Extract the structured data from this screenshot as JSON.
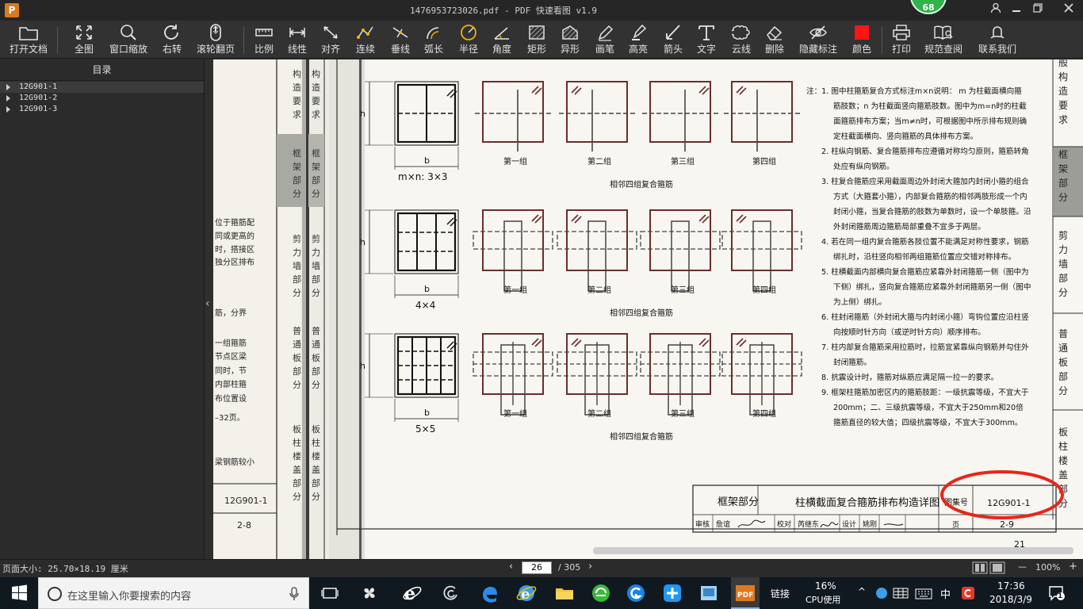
{
  "window": {
    "logo": "P",
    "title": "1476953723026.pdf - PDF 快速看图 v1.9",
    "badge": "68"
  },
  "toolbar": {
    "items": [
      {
        "id": "open",
        "label": "打开文档",
        "icon": "folder-icon"
      },
      {
        "id": "fit",
        "label": "全图",
        "icon": "fullscreen-icon"
      },
      {
        "id": "zoom-window",
        "label": "窗口缩放",
        "icon": "magnifier-icon"
      },
      {
        "id": "rotate",
        "label": "右转",
        "icon": "rotate-icon"
      },
      {
        "id": "scroll",
        "label": "滚轮翻页",
        "icon": "mouse-icon"
      },
      {
        "id": "scale",
        "label": "比例",
        "icon": "ruler-icon"
      },
      {
        "id": "linear",
        "label": "线性",
        "icon": "linear-dim-icon"
      },
      {
        "id": "align",
        "label": "对齐",
        "icon": "aligned-dim-icon"
      },
      {
        "id": "continuous",
        "label": "连续",
        "icon": "continuous-dim-icon"
      },
      {
        "id": "perp",
        "label": "垂线",
        "icon": "perpendicular-icon"
      },
      {
        "id": "arc",
        "label": "弧长",
        "icon": "arc-length-icon"
      },
      {
        "id": "radius",
        "label": "半径",
        "icon": "radius-icon"
      },
      {
        "id": "angle",
        "label": "角度",
        "icon": "angle-icon"
      },
      {
        "id": "rect",
        "label": "矩形",
        "icon": "rect-area-icon"
      },
      {
        "id": "irregular",
        "label": "异形",
        "icon": "irregular-area-icon"
      },
      {
        "id": "pen",
        "label": "画笔",
        "icon": "pen-icon"
      },
      {
        "id": "highlight",
        "label": "高亮",
        "icon": "highlighter-icon"
      },
      {
        "id": "arrow",
        "label": "箭头",
        "icon": "arrow-icon"
      },
      {
        "id": "text",
        "label": "文字",
        "icon": "text-icon"
      },
      {
        "id": "cloud",
        "label": "云线",
        "icon": "cloud-line-icon"
      },
      {
        "id": "delete",
        "label": "删除",
        "icon": "eraser-icon"
      },
      {
        "id": "hide",
        "label": "隐藏标注",
        "icon": "eye-hidden-icon"
      },
      {
        "id": "color",
        "label": "颜色",
        "icon": "color-swatch-icon",
        "color": "#ff1414"
      },
      {
        "id": "print",
        "label": "打印",
        "icon": "printer-icon"
      },
      {
        "id": "spec",
        "label": "规范查阅",
        "icon": "book-search-icon"
      },
      {
        "id": "contact",
        "label": "联系我们",
        "icon": "contact-icon"
      }
    ]
  },
  "sidebar": {
    "title": "目录",
    "items": [
      {
        "label": "12G901-1"
      },
      {
        "label": "12G901-2"
      },
      {
        "label": "12G901-3"
      }
    ]
  },
  "document": {
    "left_page": {
      "text_lines": [
        "位于箍筋配",
        "同或更高的",
        "时，搭接区",
        "独分区排布",
        "筋，分界",
        "一组箍筋",
        "节点区梁",
        "同时，节",
        "内部柱箍",
        "布位置设",
        "–32页。",
        "梁钢筋较小"
      ],
      "tabs_mid": [
        "构造要求",
        "框架部分",
        "剪力墙部分",
        "普通板部分",
        "板柱楼盖部分"
      ],
      "code": "12G901-1",
      "page": "2-8"
    },
    "figure": {
      "rows": [
        {
          "spec": "m×n:  3×3",
          "b": "b",
          "h": "h",
          "groups": [
            "第一组",
            "第二组",
            "第三组",
            "第四组"
          ],
          "caption": "相邻四组复合箍筋"
        },
        {
          "spec": "4×4",
          "b": "b",
          "h": "h",
          "groups": [
            "第一组",
            "第二组",
            "第三组",
            "第四组"
          ],
          "caption": "相邻四组复合箍筋"
        },
        {
          "spec": "5×5",
          "b": "b",
          "h": "h",
          "groups": [
            "第一组",
            "第二组",
            "第三组",
            "第四组"
          ],
          "caption": "相邻四组复合箍筋"
        }
      ]
    },
    "notes": [
      "注：1. 图中柱箍筋复合方式标注m×n说明：  m 为柱截面横向箍",
      "筋肢数；n 为柱截面竖向箍筋肢数。图中为m=n时的柱截",
      "面箍筋排布方案；当m≠n时，可根据图中所示排布规则确",
      "定柱截面横向、竖向箍筋的具体排布方案。",
      "2. 柱纵向钢筋、复合箍筋排布应遵循对称均匀原则，箍筋转角",
      "处应有纵向钢筋。",
      "3. 柱复合箍筋应采用截面周边外封闭大箍加内封闭小箍的组合",
      "方式（大箍套小箍），内部复合箍筋的相邻两肢形成一个内",
      "封闭小箍，当复合箍筋的肢数为单数时，设一个单肢箍。沿",
      "外封闭箍筋周边箍筋局部重叠不宜多于两层。",
      "4. 若在同一组内复合箍筋各肢位置不能满足对称性要求，钢筋",
      "绑扎时，沿柱竖向相邻两组箍筋位置应交错对称排布。",
      "5. 柱横截面内部横向复合箍筋应紧靠外封闭箍筋一侧（图中为",
      "下侧）绑扎，竖向复合箍筋应紧靠外封闭箍筋另一侧（图中",
      "为上侧）绑扎。",
      "6. 柱封闭箍筋（外封闭大箍与内封闭小箍）弯钩位置应沿柱竖",
      "向按顺时针方向（或逆时针方向）顺序排布。",
      "7. 柱内部复合箍筋采用拉筋时，拉筋宜紧靠纵向钢筋并勾住外",
      "封闭箍筋。",
      "8. 抗震设计时，箍筋对纵筋应满足隔一拉一的要求。",
      "9. 框架柱箍筋加密区内的箍筋肢距：一级抗震等级，不宜大于",
      "200mm；二、三级抗震等级，不宜大于250mm和20倍",
      "箍筋直径的较大值；四级抗震等级，不宜大于300mm。"
    ],
    "right_tabs": [
      "般构造要求",
      "框架部分",
      "剪力墙部分",
      "普通板部分",
      "板柱楼盖部分"
    ],
    "title_block": {
      "section": "框架部分",
      "title": "柱横截面复合箍筋排布构造详图",
      "code_label": "图集号",
      "code": "12G901-1",
      "review_label": "审核",
      "reviewer": "詹谊",
      "check_label": "校对",
      "checker": "芮继东",
      "design_label": "设计",
      "designer": "姚刚",
      "page_label": "页",
      "page": "2-9"
    },
    "page_corner": "21",
    "highlight_color": "#e8261a"
  },
  "status": {
    "page_size": "页面大小: 25.70×18.19 厘米",
    "current_page": "26",
    "total_pages": "/ 305",
    "zoom": "100%",
    "zoom_minus": "—",
    "zoom_plus": "+"
  },
  "taskbar": {
    "search_placeholder": "在这里输入你要搜索的内容",
    "link_label": "链接",
    "cpu_value": "16%",
    "cpu_label": "CPU使用",
    "ime": "中",
    "time": "17:36",
    "date": "2018/3/9",
    "notification_count": "1"
  }
}
